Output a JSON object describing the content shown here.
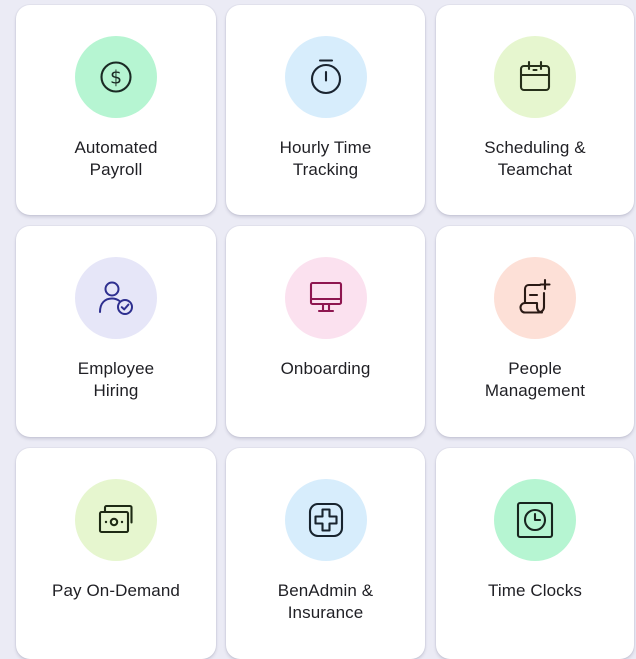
{
  "features": [
    {
      "id": "automated-payroll",
      "lines": [
        "Automated",
        "Payroll"
      ],
      "icon": "dollar-circle-icon",
      "bg": "#b6f5d2",
      "stroke": "#1a2a24"
    },
    {
      "id": "hourly-time-tracking",
      "lines": [
        "Hourly Time",
        "Tracking"
      ],
      "icon": "stopwatch-icon",
      "bg": "#d7edfc",
      "stroke": "#1a2430"
    },
    {
      "id": "scheduling-teamchat",
      "lines": [
        "Scheduling &",
        "Teamchat"
      ],
      "icon": "calendar-icon",
      "bg": "#e6f6cf",
      "stroke": "#26301a"
    },
    {
      "id": "employee-hiring",
      "lines": [
        "Employee",
        "Hiring"
      ],
      "icon": "person-check-icon",
      "bg": "#e6e6f8",
      "stroke": "#2e2f8f"
    },
    {
      "id": "onboarding",
      "lines": [
        "Onboarding"
      ],
      "icon": "monitor-icon",
      "bg": "#fbe1ef",
      "stroke": "#8e1650"
    },
    {
      "id": "people-management",
      "lines": [
        "People",
        "Management"
      ],
      "icon": "document-add-icon",
      "bg": "#fde0d7",
      "stroke": "#2a1a15"
    },
    {
      "id": "pay-on-demand",
      "lines": [
        "Pay On-Demand"
      ],
      "icon": "cash-icon",
      "bg": "#e6f6cf",
      "stroke": "#1e2a14"
    },
    {
      "id": "benadmin-insurance",
      "lines": [
        "BenAdmin &",
        "Insurance"
      ],
      "icon": "medical-cross-icon",
      "bg": "#d7edfc",
      "stroke": "#18242e"
    },
    {
      "id": "time-clocks",
      "lines": [
        "Time Clocks"
      ],
      "icon": "clock-icon",
      "bg": "#b6f5d2",
      "stroke": "#18261f"
    }
  ]
}
